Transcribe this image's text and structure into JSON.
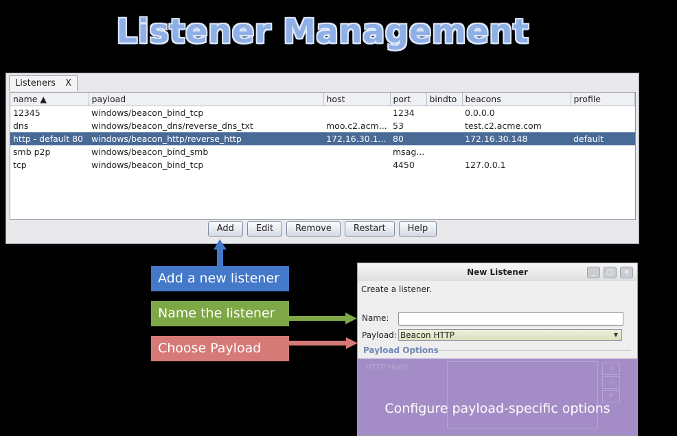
{
  "slide": {
    "title": "Listener Management"
  },
  "listeners_window": {
    "tab_label": "Listeners",
    "tab_close": "X",
    "columns": [
      "name ▲",
      "payload",
      "host",
      "port",
      "bindto",
      "beacons",
      "profile"
    ],
    "rows": [
      [
        "12345",
        "windows/beacon_bind_tcp",
        "",
        "1234",
        "",
        "0.0.0.0",
        ""
      ],
      [
        "dns",
        "windows/beacon_dns/reverse_dns_txt",
        "moo.c2.acm...",
        "53",
        "",
        "test.c2.acme.com",
        ""
      ],
      [
        "http - default 80",
        "windows/beacon_http/reverse_http",
        "172.16.30.1...",
        "80",
        "",
        "172.16.30.148",
        "default"
      ],
      [
        "smb p2p",
        "windows/beacon_bind_smb",
        "",
        "msag...",
        "",
        "",
        ""
      ],
      [
        "tcp",
        "windows/beacon_bind_tcp",
        "",
        "4450",
        "",
        "127.0.0.1",
        ""
      ]
    ],
    "selected_row": 2,
    "buttons": [
      "Add",
      "Edit",
      "Remove",
      "Restart",
      "Help"
    ]
  },
  "callouts": {
    "add": "Add a new listener",
    "name": "Name the listener",
    "payload": "Choose Payload"
  },
  "dialog": {
    "title": "New Listener",
    "subtitle": "Create a listener.",
    "name_label": "Name:",
    "name_value": "",
    "payload_label": "Payload:",
    "payload_value": "Beacon HTTP",
    "options_legend": "Payload Options",
    "hosts_label": "HTTP Hosts",
    "overlay_text": "Configure payload-specific options"
  },
  "colors": {
    "callout_blue": "#4478c8",
    "callout_green": "#7ea845",
    "callout_red": "#d67a78",
    "overlay_purple": "#a48cc6",
    "selection": "#4a6a96"
  }
}
